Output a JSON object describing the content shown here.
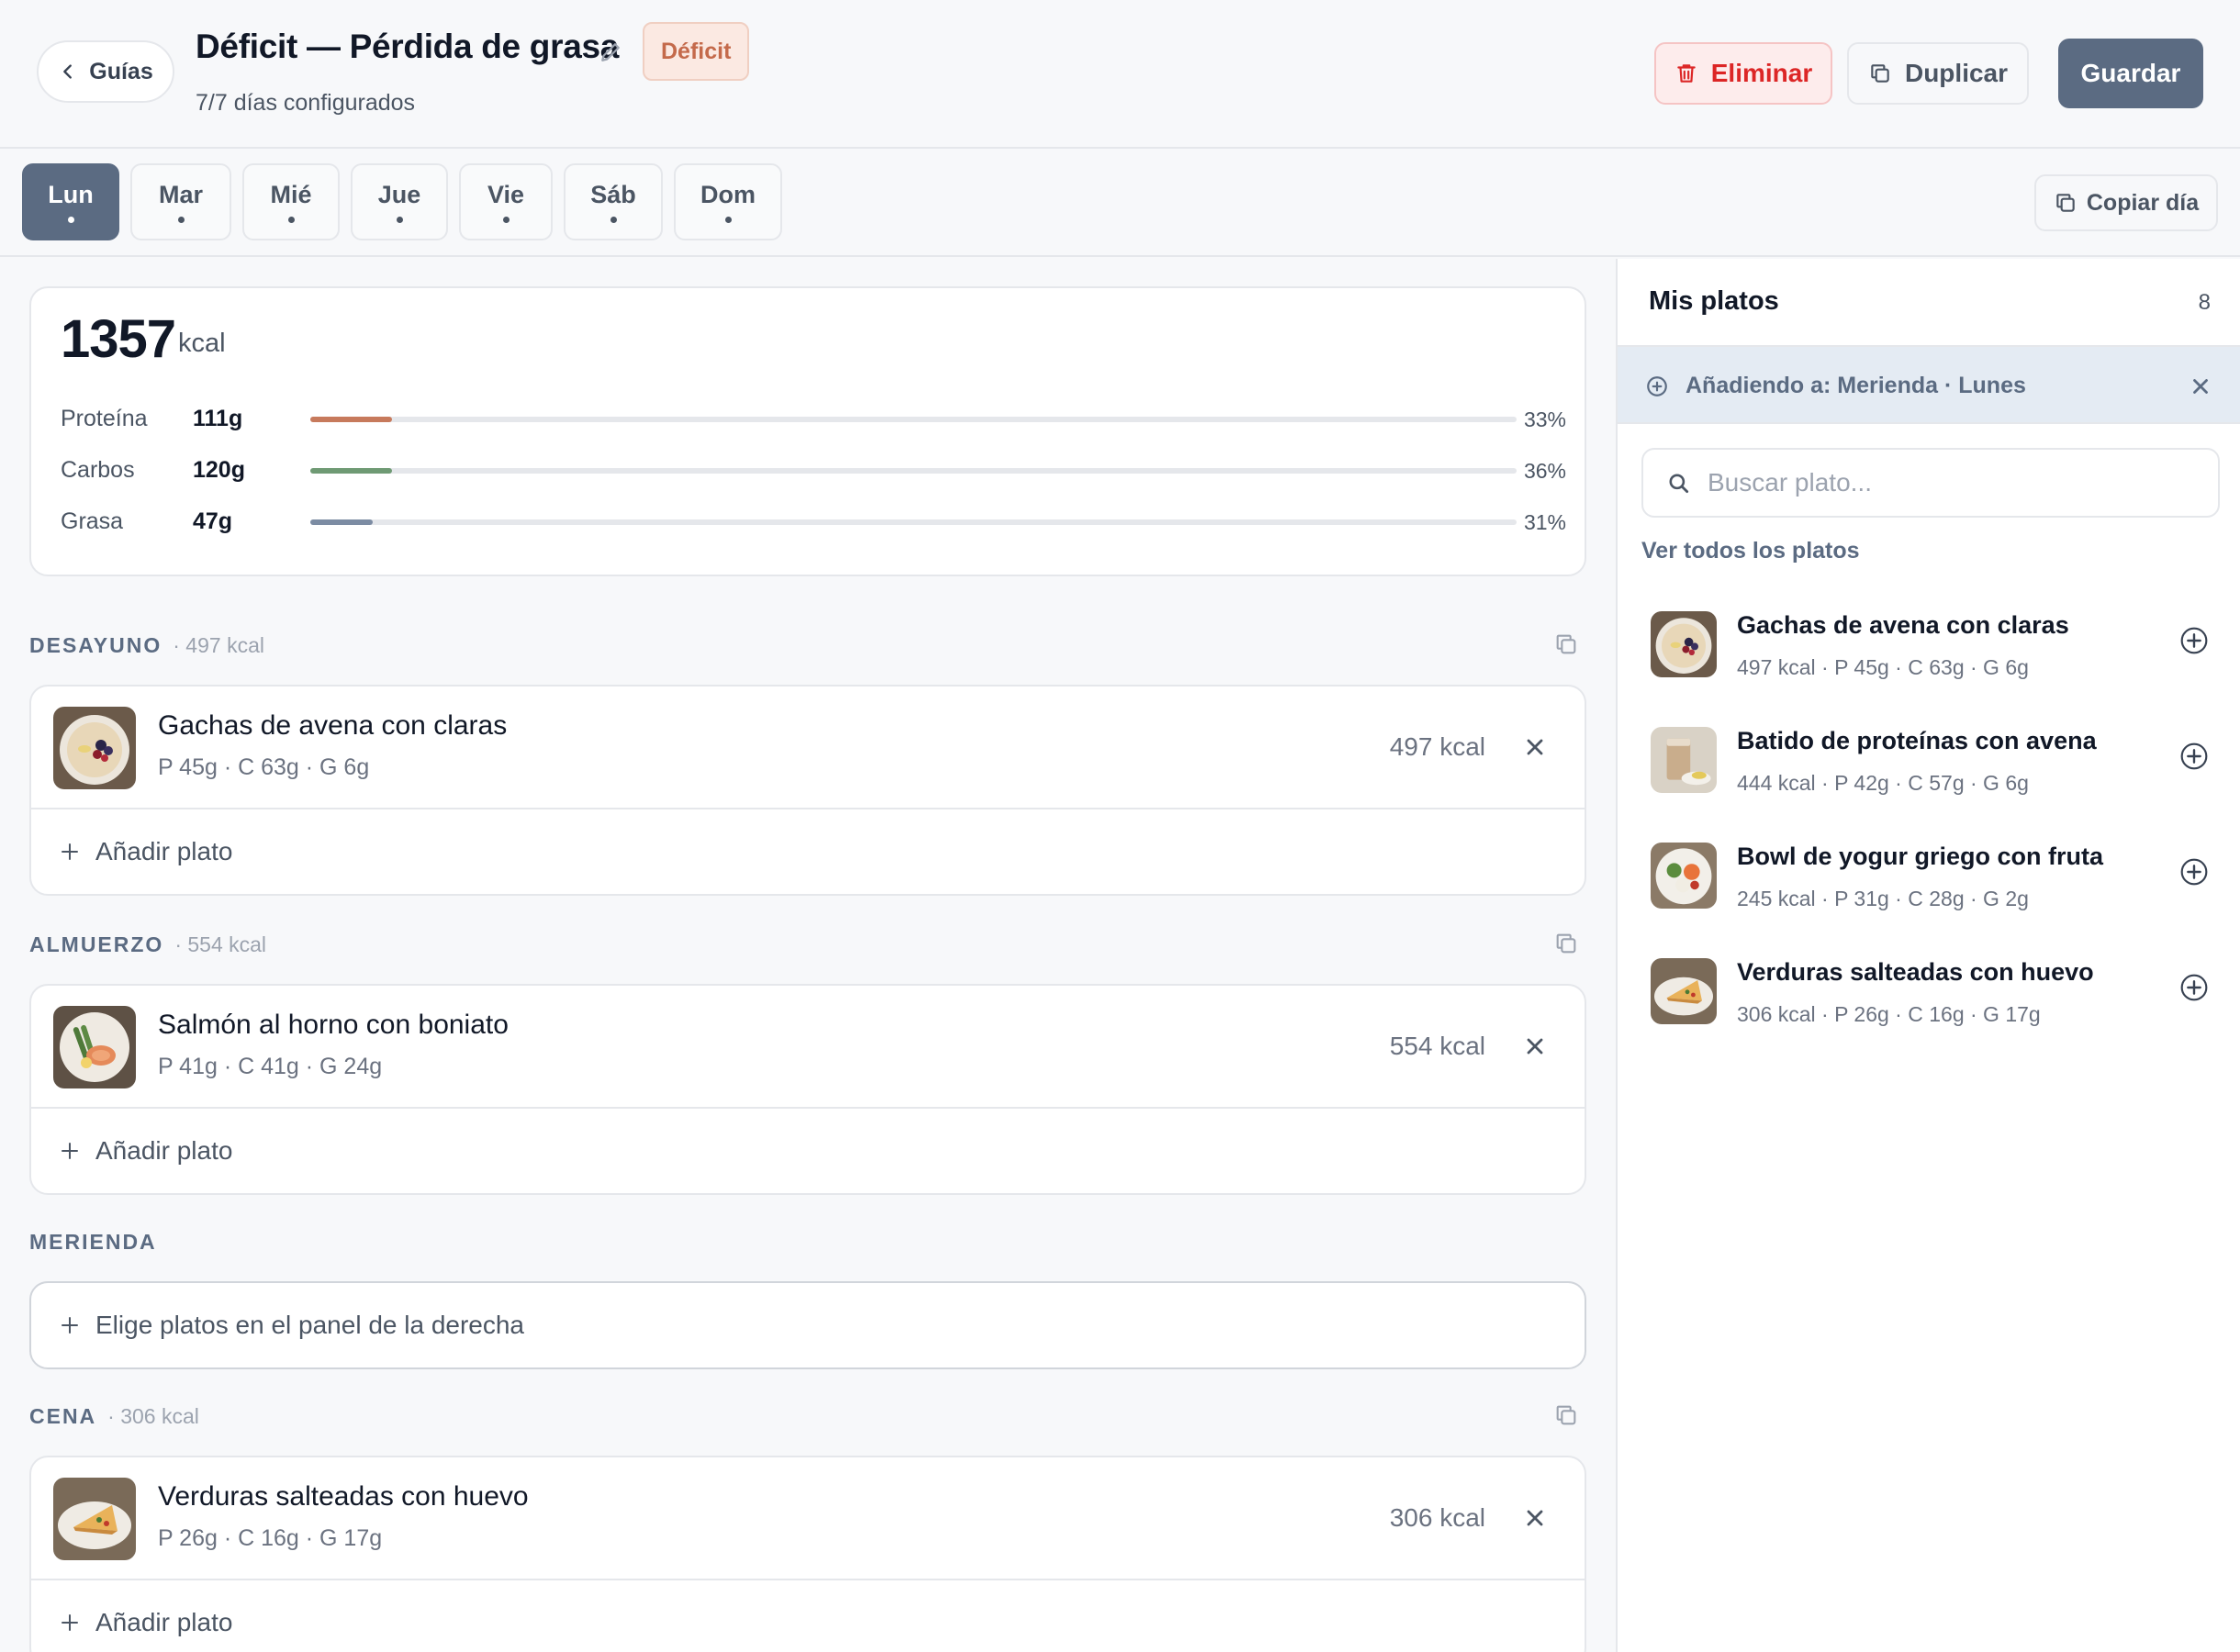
{
  "header": {
    "back_label": "Guías",
    "title": "Déficit — Pérdida de grasa",
    "badge": "Déficit",
    "subtitle": "7/7 días configurados",
    "delete_label": "Eliminar",
    "duplicate_label": "Duplicar",
    "save_label": "Guardar"
  },
  "days": {
    "items": [
      {
        "label": "Lun",
        "active": true
      },
      {
        "label": "Mar",
        "active": false
      },
      {
        "label": "Mié",
        "active": false
      },
      {
        "label": "Jue",
        "active": false
      },
      {
        "label": "Vie",
        "active": false
      },
      {
        "label": "Sáb",
        "active": false
      },
      {
        "label": "Dom",
        "active": false
      }
    ],
    "copy_day_label": "Copiar día"
  },
  "summary": {
    "kcal": "1357",
    "kcal_unit": "kcal",
    "macros": [
      {
        "name": "Proteína",
        "grams": "111g",
        "percent": "33%",
        "bar_fill": 0.068,
        "color": "#c77a5c"
      },
      {
        "name": "Carbos",
        "grams": "120g",
        "percent": "36%",
        "bar_fill": 0.068,
        "color": "#6f9a74"
      },
      {
        "name": "Grasa",
        "grams": "47g",
        "percent": "31%",
        "bar_fill": 0.052,
        "color": "#7c8ca3"
      }
    ]
  },
  "meals": {
    "desayuno": {
      "label": "DESAYUNO",
      "kcal": "· 497 kcal",
      "dishes": [
        {
          "name": "Gachas de avena con claras",
          "macros": "P 45g · C 63g · G 6g",
          "kcal": "497 kcal",
          "icon": "oatmeal-bowl"
        }
      ],
      "add_label": "Añadir plato"
    },
    "almuerzo": {
      "label": "ALMUERZO",
      "kcal": "· 554 kcal",
      "dishes": [
        {
          "name": "Salmón al horno con boniato",
          "macros": "P 41g · C 41g · G 24g",
          "kcal": "554 kcal",
          "icon": "salmon-plate"
        }
      ],
      "add_label": "Añadir plato"
    },
    "merienda": {
      "label": "MERIENDA",
      "empty_label": "Elige platos en el panel de la derecha"
    },
    "cena": {
      "label": "CENA",
      "kcal": "· 306 kcal",
      "dishes": [
        {
          "name": "Verduras salteadas con huevo",
          "macros": "P 26g · C 16g · G 17g",
          "kcal": "306 kcal",
          "icon": "egg-plate"
        }
      ],
      "add_label": "Añadir plato"
    }
  },
  "sidebar": {
    "title": "Mis platos",
    "count": "8",
    "adding_text": "Añadiendo a: Merienda · Lunes",
    "search_placeholder": "Buscar plato...",
    "see_all_label": "Ver todos los platos",
    "items": [
      {
        "name": "Gachas de avena con claras",
        "meta": "497 kcal · P 45g · C 63g · G 6g",
        "icon": "oatmeal-bowl"
      },
      {
        "name": "Batido de proteínas con avena",
        "meta": "444 kcal · P 42g · C 57g · G 6g",
        "icon": "shake-glass"
      },
      {
        "name": "Bowl de yogur griego con fruta",
        "meta": "245 kcal · P 31g · C 28g · G 2g",
        "icon": "yogurt-bowl"
      },
      {
        "name": "Verduras salteadas con huevo",
        "meta": "306 kcal · P 26g · C 16g · G 17g",
        "icon": "egg-plate"
      }
    ]
  }
}
